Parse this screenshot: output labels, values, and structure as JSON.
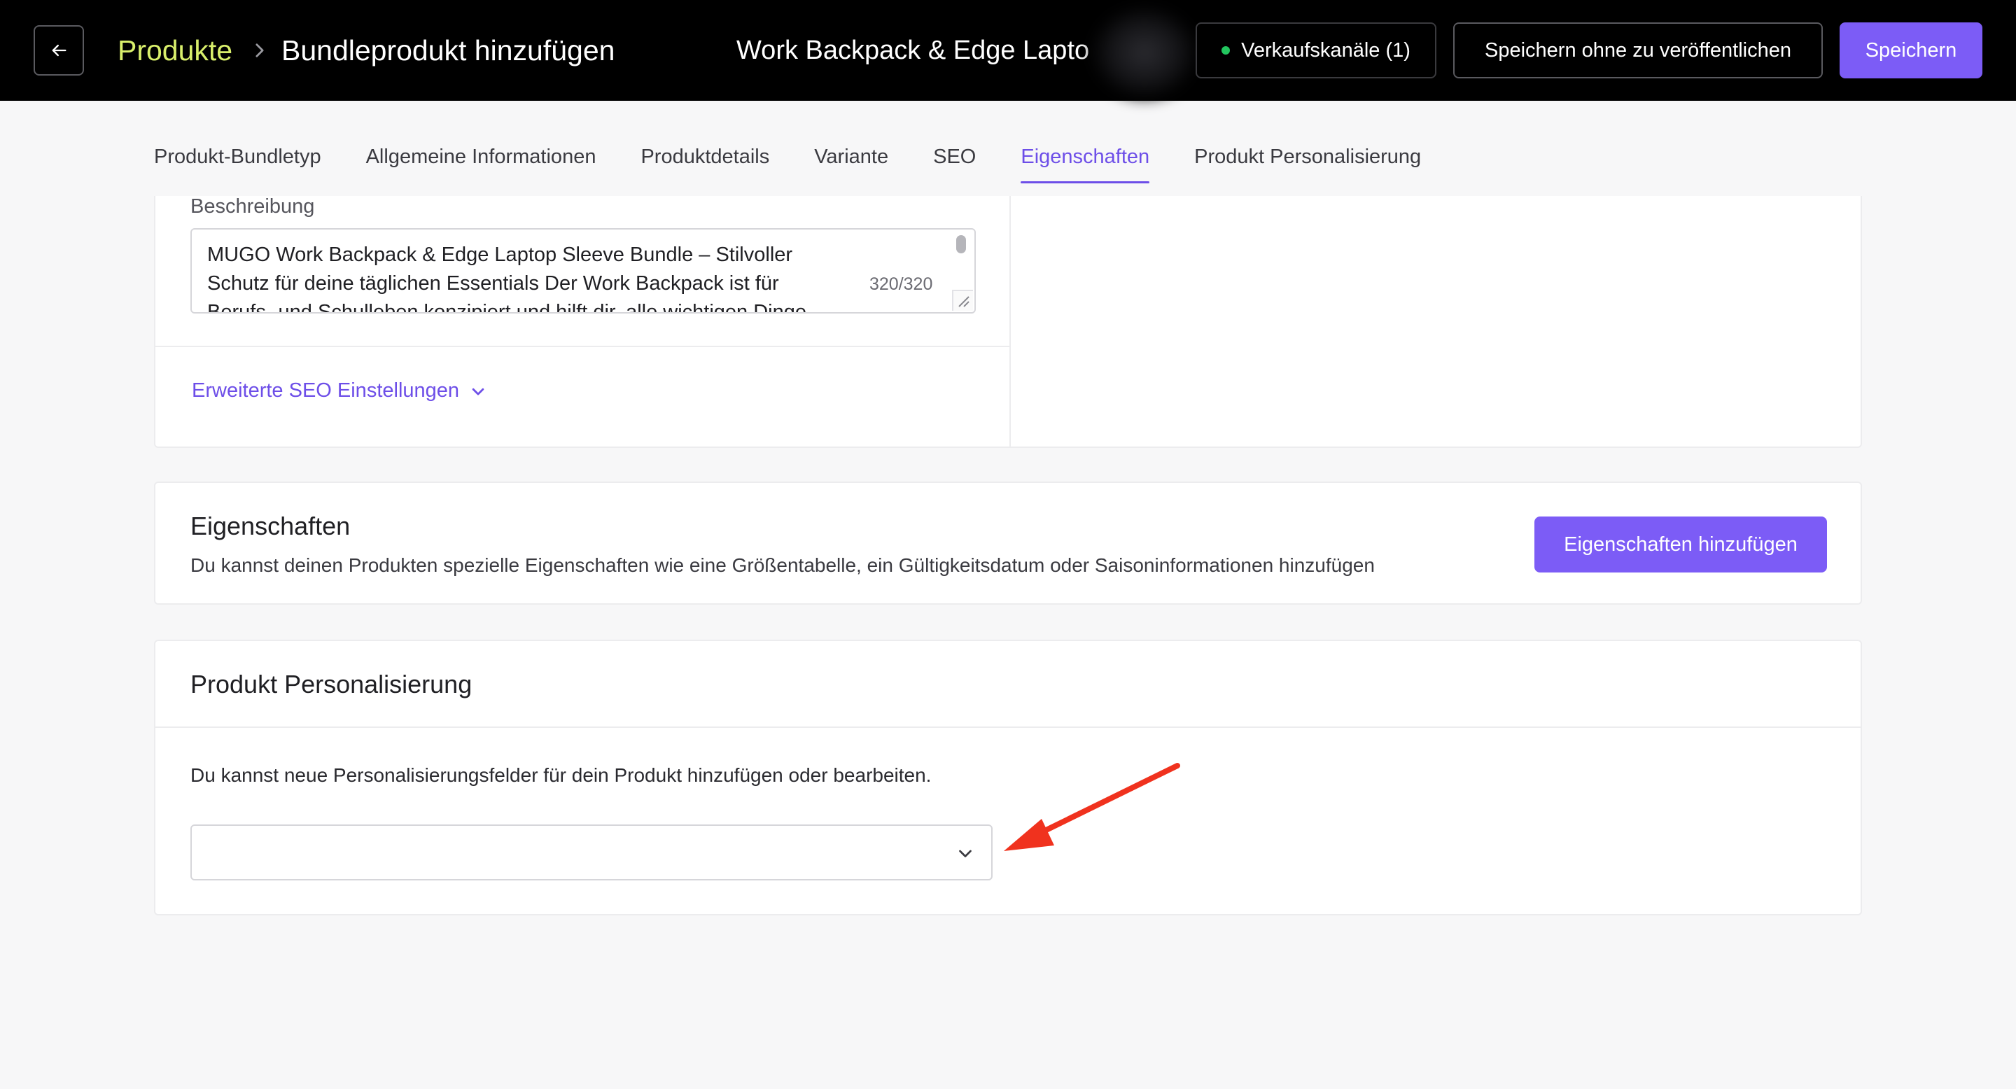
{
  "header": {
    "back_icon": "arrow-left-icon",
    "breadcrumb_root": "Produkte",
    "breadcrumb_separator_icon": "chevron-right-icon",
    "breadcrumb_current": "Bundleprodukt hinzufügen",
    "product_name": "Work Backpack & Edge Lapto",
    "sales_channels_label": "Verkaufskanäle (1)",
    "sales_channels_status_color": "#22c55e",
    "save_draft_label": "Speichern ohne zu veröffentlichen",
    "save_label": "Speichern",
    "accent_color": "#7c5cf6"
  },
  "tabs": [
    {
      "label": "Produkt-Bundletyp",
      "active": false
    },
    {
      "label": "Allgemeine Informationen",
      "active": false
    },
    {
      "label": "Produktdetails",
      "active": false
    },
    {
      "label": "Variante",
      "active": false
    },
    {
      "label": "SEO",
      "active": false
    },
    {
      "label": "Eigenschaften",
      "active": true
    },
    {
      "label": "Produkt Personalisierung",
      "active": false
    }
  ],
  "seo": {
    "description_label": "Beschreibung",
    "description_value": "MUGO Work Backpack & Edge Laptop Sleeve Bundle – Stilvoller Schutz für deine täglichen Essentials Der Work Backpack ist für Berufs- und Schulleben konzipiert und hilft dir, alle wichtigen Dinge",
    "description_counter": "320/320",
    "advanced_link": "Erweiterte SEO Einstellungen",
    "advanced_icon": "chevron-down-icon"
  },
  "properties": {
    "title": "Eigenschaften",
    "description": "Du kannst deinen Produkten spezielle Eigenschaften wie eine Größentabelle, ein Gültigkeitsdatum oder Saisoninformationen hinzufügen",
    "add_button": "Eigenschaften hinzufügen"
  },
  "personalization": {
    "title": "Produkt Personalisierung",
    "description": "Du kannst neue Personalisierungsfelder für dein Produkt hinzufügen oder bearbeiten.",
    "select_value": "",
    "select_icon": "chevron-down-icon",
    "annotation_color": "#f0321e"
  }
}
